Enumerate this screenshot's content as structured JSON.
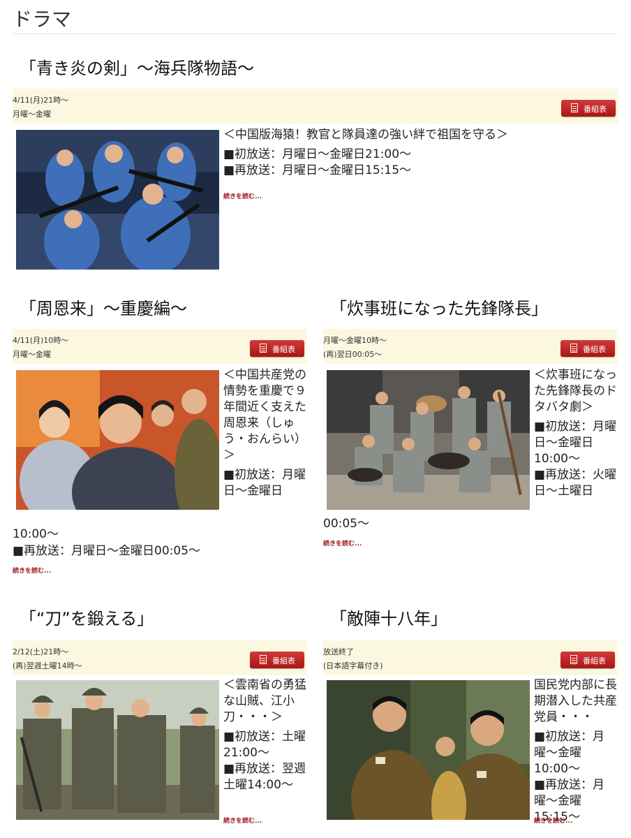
{
  "page": {
    "title": "ドラマ"
  },
  "colors": {
    "strip_bg": "#fcf8e0",
    "button_red": "#c42626",
    "more_link": "#9a1c1c"
  },
  "programs": [
    {
      "title": "「青き炎の剣」〜海兵隊物語〜",
      "meta1": "4/11(月)21時〜",
      "meta2": "月曜〜金曜",
      "button": "番組表",
      "desc": [
        "＜中国版海猿！教官と隊員達の強い絆で祖国を守る＞",
        "■初放送：月曜日〜金曜日21:00〜",
        "■再放送：月曜日〜金曜日15:15〜"
      ],
      "more": "続きを読む..."
    },
    {
      "title": "「周恩来」〜重慶編〜",
      "meta1": "4/11(月)10時〜",
      "meta2": "月曜〜金曜",
      "button": "番組表",
      "desc": [
        "＜中国共産党の情勢を重慶で９年間近く支えた周恩来（しゅう・おんらい）＞",
        "■初放送：月曜日〜金曜日"
      ],
      "overflow": [
        "10:00〜",
        "■再放送：月曜日〜金曜日00:05〜"
      ],
      "more": "続きを読む..."
    },
    {
      "title": "「炊事班になった先鋒隊長」",
      "meta1": "月曜〜金曜10時〜",
      "meta2": "(再)翌日00:05〜",
      "button": "番組表",
      "desc": [
        "＜炊事班になった先鋒隊長のドタバタ劇＞",
        "■初放送：月曜日〜金曜日10:00〜",
        "■再放送：火曜日〜土曜日"
      ],
      "overflow": [
        "00:05〜"
      ],
      "more": "続きを読む..."
    },
    {
      "title": "「“刀”を鍛える」",
      "meta1": "2/12(土)21時〜",
      "meta2": "(再)翌週土曜14時〜",
      "button": "番組表",
      "desc": [
        "＜雲南省の勇猛な山賊、江小刀・・・＞",
        "■初放送：土曜21:00〜",
        "■再放送：翌週土曜14:00〜"
      ],
      "more": "続きを読む..."
    },
    {
      "title": "「敵陣十八年」",
      "meta1": "放送終了",
      "meta2": "(日本語字幕付き)",
      "button": "番組表",
      "desc": [
        "国民党内部に長期潜入した共産党員・・・",
        "■初放送：月曜〜金曜10:00〜",
        "■再放送：月曜〜金曜15:15〜"
      ],
      "more": "続きを読む..."
    }
  ]
}
